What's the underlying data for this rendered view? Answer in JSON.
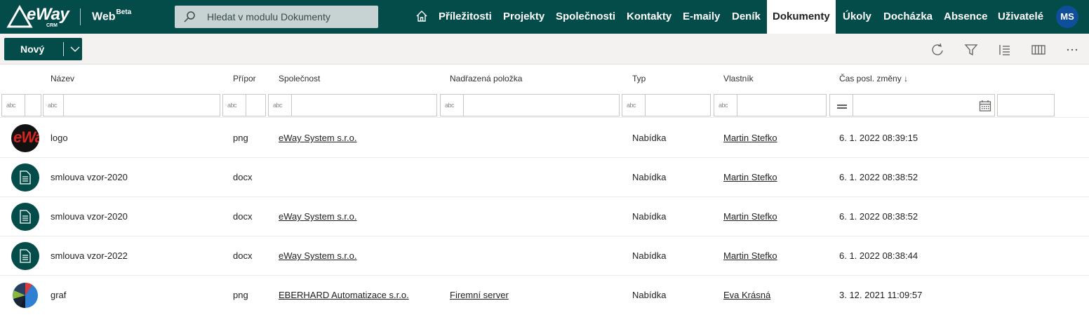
{
  "app": {
    "logo_text": "eWay",
    "logo_sub": "CRM",
    "title": "Web",
    "title_badge": "Beta"
  },
  "search": {
    "placeholder": "Hledat v modulu Dokumenty"
  },
  "nav": {
    "items": [
      "Příležitosti",
      "Projekty",
      "Společnosti",
      "Kontakty",
      "E-maily",
      "Deník",
      "Dokumenty",
      "Úkoly",
      "Docházka",
      "Absence",
      "Uživatelé"
    ],
    "active": "Dokumenty"
  },
  "user": {
    "initials": "MS"
  },
  "toolbar": {
    "new_label": "Nový"
  },
  "columns": [
    "Název",
    "Přípor",
    "Společnost",
    "Nadřazená položka",
    "Typ",
    "Vlastník",
    "Čas posl. změny ↓"
  ],
  "filter": {
    "text_icon": "abc"
  },
  "rows": [
    {
      "thumb": "logo",
      "name": "logo",
      "ext": "png",
      "company": "eWay System s.r.o.",
      "parent": "",
      "type": "Nabídka",
      "owner": "Martin Stefko",
      "modified": "6. 1. 2022 08:39:15"
    },
    {
      "thumb": "doc",
      "name": "smlouva vzor-2020",
      "ext": "docx",
      "company": "",
      "parent": "",
      "type": "Nabídka",
      "owner": "Martin Stefko",
      "modified": "6. 1. 2022 08:38:52"
    },
    {
      "thumb": "doc",
      "name": "smlouva vzor-2020",
      "ext": "docx",
      "company": "eWay System s.r.o.",
      "parent": "",
      "type": "Nabídka",
      "owner": "Martin Stefko",
      "modified": "6. 1. 2022 08:38:52"
    },
    {
      "thumb": "doc",
      "name": "smlouva vzor-2022",
      "ext": "docx",
      "company": "eWay System s.r.o.",
      "parent": "",
      "type": "Nabídka",
      "owner": "Martin Stefko",
      "modified": "6. 1. 2022 08:38:44"
    },
    {
      "thumb": "pie",
      "name": "graf",
      "ext": "png",
      "company": "EBERHARD Automatizace s.r.o.",
      "parent": "Firemní server",
      "type": "Nabídka",
      "owner": "Eva Krásná",
      "modified": "3. 12. 2021 11:09:57"
    }
  ],
  "icons": {
    "search": "search-icon",
    "home": "home-icon",
    "refresh": "refresh-icon",
    "filter": "filter-icon",
    "list": "list-icon",
    "columns": "columns-icon",
    "more": "more-icon",
    "calendar": "calendar-icon",
    "chevron": "chevron-down-icon"
  },
  "colors": {
    "brand": "#034c4a",
    "avatar": "#0f4f9a",
    "logo_red": "#d5261f"
  }
}
